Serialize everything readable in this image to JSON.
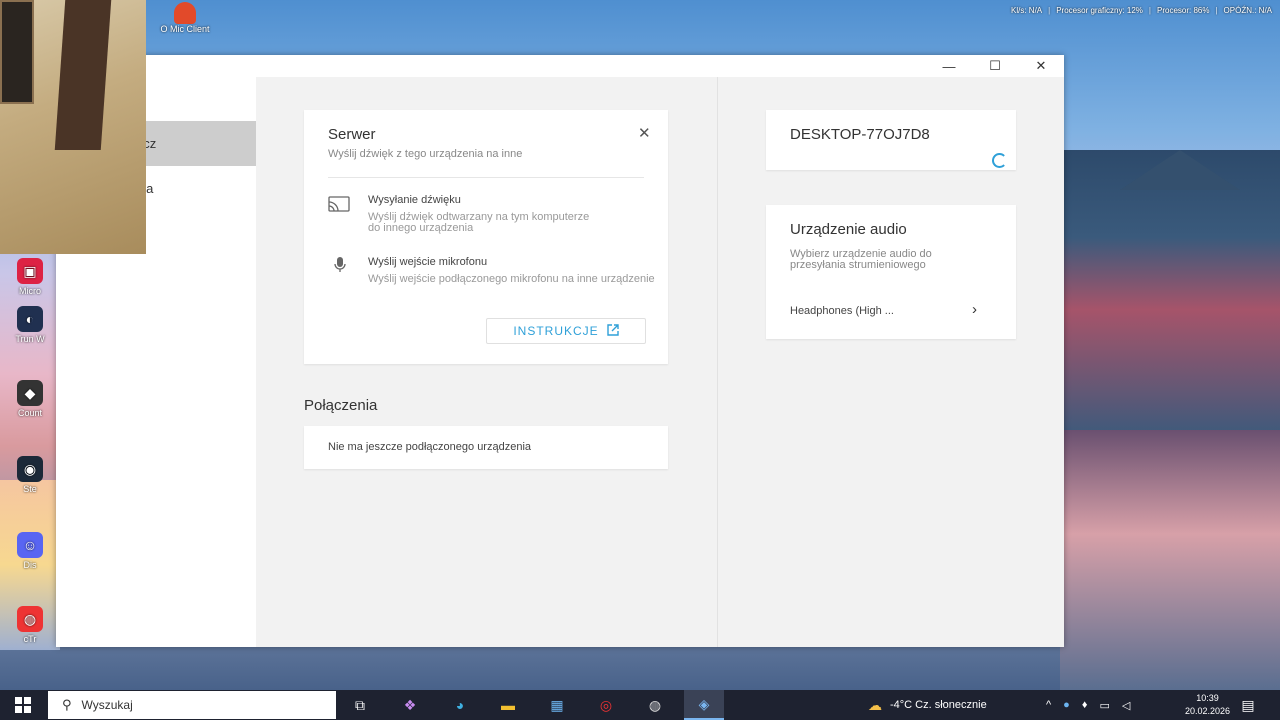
{
  "system_stats": {
    "kls": "Kl/s: N/A",
    "gpu": "Procesor graficzny: 12%",
    "cpu": "Procesor: 86%",
    "delay": "OPÓŹN.: N/A"
  },
  "desktop": {
    "mic_client_label": "O Mic Client",
    "icons": [
      {
        "label": "Micro",
        "icon": "app-icon"
      },
      {
        "label": "Trun W",
        "icon": "app-icon"
      },
      {
        "label": "Count",
        "icon": "app-icon"
      },
      {
        "label": "Ste",
        "icon": "steam-icon"
      },
      {
        "label": "Dis",
        "icon": "discord-icon"
      },
      {
        "label": "cTr",
        "icon": "app-icon"
      }
    ]
  },
  "window": {
    "controls": {
      "minimize": "—",
      "maximize": "☐",
      "close": "✕"
    },
    "sidebar": {
      "items": [
        {
          "label": "acz",
          "active": true
        },
        {
          "label": "nia",
          "active": false
        }
      ]
    },
    "server_card": {
      "title": "Serwer",
      "subtitle": "Wyślij dźwięk z tego urządzenia na inne",
      "options": [
        {
          "title": "Wysyłanie dźwięku",
          "desc": "Wyślij dźwięk odtwarzany na tym komputerze do innego urządzenia",
          "icon": "cast-icon"
        },
        {
          "title": "Wyślij wejście mikrofonu",
          "desc": "Wyślij wejście podłączonego mikrofonu na inne urządzenie",
          "icon": "mic-icon"
        }
      ],
      "button_label": "INSTRUKCJE"
    },
    "connections": {
      "title": "Połączenia",
      "empty_text": "Nie ma jeszcze podłączonego urządzenia"
    },
    "device_card": {
      "name": "DESKTOP-77OJ7D8"
    },
    "audio_card": {
      "title": "Urządzenie audio",
      "subtitle": "Wybierz urządzenie audio do przesyłania strumieniowego",
      "device": "Headphones (High ..."
    }
  },
  "taskbar": {
    "search_placeholder": "Wyszukaj",
    "weather": "-4°C  Cz. słonecznie",
    "time": "10:39",
    "date": "20.02.2026"
  },
  "colors": {
    "accent": "#2fa0d8",
    "sidebar_active": "#cdcdcd"
  }
}
